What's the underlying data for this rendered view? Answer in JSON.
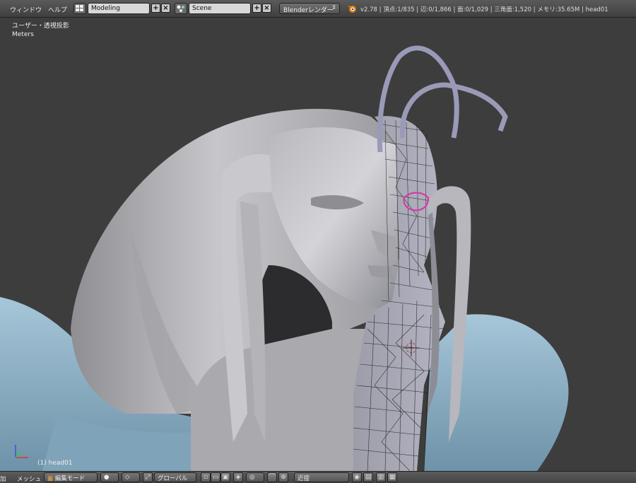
{
  "menu": {
    "window": "ウィンドウ",
    "help": "ヘルプ"
  },
  "screen_layout": {
    "value": "Modeling",
    "icon": "layout-grid-icon"
  },
  "scene": {
    "value": "Scene",
    "icon": "scene-icon"
  },
  "renderer": {
    "value": "Blenderレンダー"
  },
  "stats": "v2.78 | 頂点:1/835 | 辺:0/1,866 | 面:0/1,029 | 三角面:1,520 | メモリ:35.65M | head01",
  "viewport": {
    "view_label": "ユーザー・透視投影",
    "units": "Meters",
    "object_label": "(1) head01"
  },
  "bottom": {
    "add_fragment": "加",
    "mesh_menu": "メッシュ",
    "mode": "編集モード",
    "orientation": "グローバル",
    "snap": "近接"
  },
  "colors": {
    "viewport_bg": "#3d3d3d",
    "model_grey": "#b9b9bd",
    "model_blue": "#8fb3c9",
    "antenna": "#9a9ab8",
    "selection_pink": "#d63aa6",
    "wire": "#111111"
  }
}
